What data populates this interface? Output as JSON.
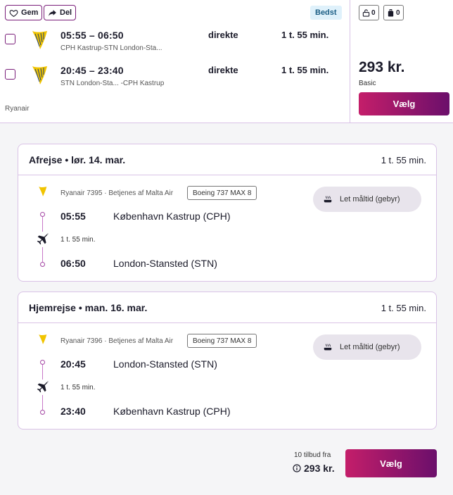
{
  "actions": {
    "save_label": "Gem",
    "share_label": "Del"
  },
  "badge": "Bedst",
  "legs": [
    {
      "times": "05:55 – 06:50",
      "route": "CPH Kastrup-STN London-Sta...",
      "stops": "direkte",
      "duration": "1 t. 55 min."
    },
    {
      "times": "20:45 – 23:40",
      "route": "STN London-Sta... -CPH Kastrup",
      "stops": "direkte",
      "duration": "1 t. 55 min."
    }
  ],
  "airline": "Ryanair",
  "baggage": {
    "personal_item": "0",
    "cabin_bag": "0"
  },
  "price": "293 kr.",
  "fare": "Basic",
  "select_label": "Vælg",
  "details": [
    {
      "title": "Afrejse • lør. 14. mar.",
      "duration": "1 t. 55 min.",
      "flight_info": "Ryanair 7395 · Betjenes af Malta Air",
      "aircraft": "Boeing 737 MAX 8",
      "meal": "Let måltid (gebyr)",
      "dep_time": "05:55",
      "dep_place": "København Kastrup (CPH)",
      "seg_duration": "1 t. 55 min.",
      "arr_time": "06:50",
      "arr_place": "London-Stansted (STN)"
    },
    {
      "title": "Hjemrejse • man. 16. mar.",
      "duration": "1 t. 55 min.",
      "flight_info": "Ryanair 7396 · Betjenes af Malta Air",
      "aircraft": "Boeing 737 MAX 8",
      "meal": "Let måltid (gebyr)",
      "dep_time": "20:45",
      "dep_place": "London-Stansted (STN)",
      "seg_duration": "1 t. 55 min.",
      "arr_time": "23:40",
      "arr_place": "København Kastrup (CPH)"
    }
  ],
  "footer": {
    "offers": "10 tilbud fra",
    "price": "293 kr.",
    "select_label": "Vælg"
  },
  "icons": {
    "heart": "heart-icon",
    "share": "share-arrow-icon",
    "airline_logo": "ryanair-harp-logo",
    "personal_bag": "personal-item-icon",
    "cabin_bag": "cabin-bag-icon",
    "meal": "meal-icon",
    "plane": "plane-icon",
    "info": "info-icon"
  },
  "colors": {
    "accent_start": "#c41e6a",
    "accent_end": "#6b0f6b",
    "border": "#d9c2e6",
    "badge_bg": "#dff1fb"
  }
}
